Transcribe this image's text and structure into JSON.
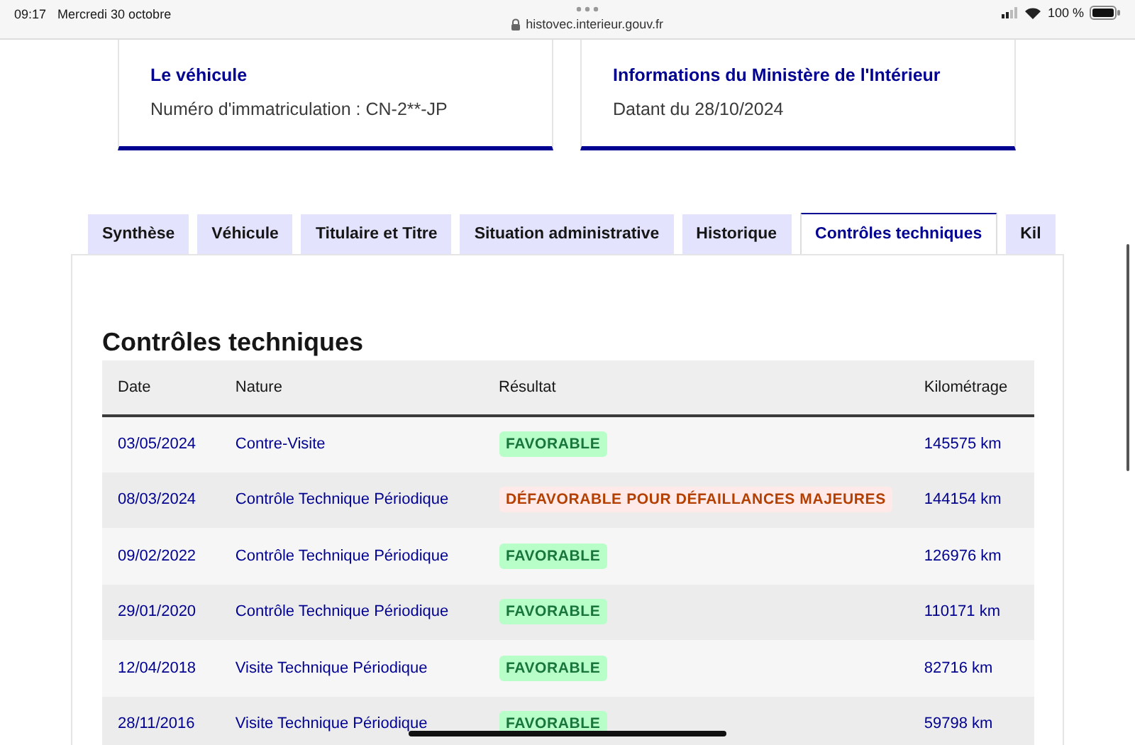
{
  "status_bar": {
    "time": "09:17",
    "date": "Mercredi 30 octobre",
    "url": "histovec.interieur.gouv.fr",
    "battery": "100 %"
  },
  "cards": [
    {
      "title": "Le véhicule",
      "text": "Numéro d'immatriculation : CN-2**-JP"
    },
    {
      "title": "Informations du Ministère de l'Intérieur",
      "text": "Datant du 28/10/2024"
    }
  ],
  "tabs": [
    {
      "label": "Synthèse",
      "selected": false
    },
    {
      "label": "Véhicule",
      "selected": false
    },
    {
      "label": "Titulaire et Titre",
      "selected": false
    },
    {
      "label": "Situation administrative",
      "selected": false
    },
    {
      "label": "Historique",
      "selected": false
    },
    {
      "label": "Contrôles techniques",
      "selected": true
    },
    {
      "label": "Kil",
      "selected": false
    }
  ],
  "section_title": "Contrôles techniques",
  "table": {
    "columns": [
      "Date",
      "Nature",
      "Résultat",
      "Kilométrage"
    ],
    "rows": [
      {
        "date": "03/05/2024",
        "nature": "Contre-Visite",
        "result": "FAVORABLE",
        "kind": "favorable",
        "km": "145575 km"
      },
      {
        "date": "08/03/2024",
        "nature": "Contrôle Technique Périodique",
        "result": "DÉFAVORABLE POUR DÉFAILLANCES MAJEURES",
        "kind": "defavorable",
        "km": "144154 km"
      },
      {
        "date": "09/02/2022",
        "nature": "Contrôle Technique Périodique",
        "result": "FAVORABLE",
        "kind": "favorable",
        "km": "126976 km"
      },
      {
        "date": "29/01/2020",
        "nature": "Contrôle Technique Périodique",
        "result": "FAVORABLE",
        "kind": "favorable",
        "km": "110171 km"
      },
      {
        "date": "12/04/2018",
        "nature": "Visite Technique Périodique",
        "result": "FAVORABLE",
        "kind": "favorable",
        "km": "82716 km"
      },
      {
        "date": "28/11/2016",
        "nature": "Visite Technique Périodique",
        "result": "FAVORABLE",
        "kind": "favorable",
        "km": "59798 km"
      }
    ]
  }
}
